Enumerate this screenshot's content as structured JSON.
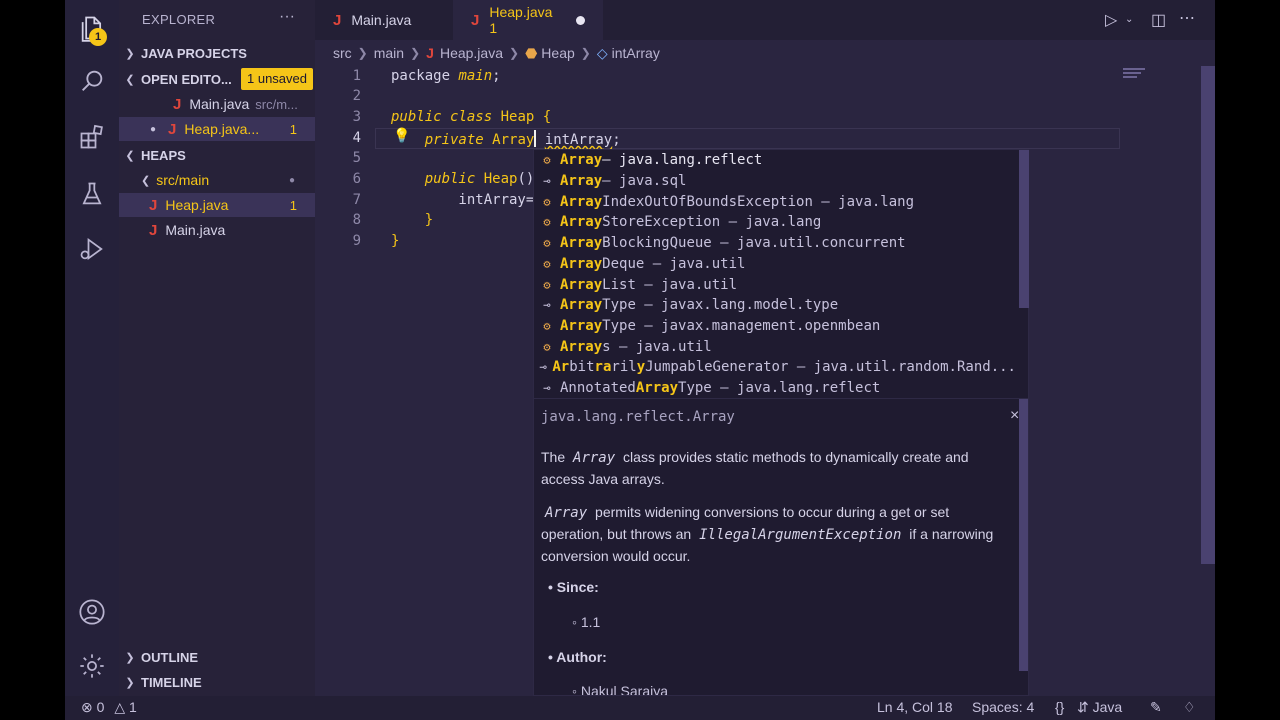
{
  "colors": {
    "accent": "#f5c518",
    "background": "#2a2540",
    "java_icon": "#e0463c"
  },
  "activity": {
    "explorer_badge": "1"
  },
  "sidebar": {
    "title": "EXPLORER",
    "more": "···",
    "java_projects": "JAVA PROJECTS",
    "open_editors": "OPEN EDITO...",
    "unsaved_pill": "1 unsaved",
    "open_files": [
      {
        "icon": "J",
        "name": "Main.java",
        "path": "src/m..."
      },
      {
        "icon": "J",
        "name": "Heap.java...",
        "count": "1"
      }
    ],
    "heaps": "HEAPS",
    "folder": "src/main",
    "tree_files": [
      {
        "icon": "J",
        "name": "Heap.java",
        "count": "1"
      },
      {
        "icon": "J",
        "name": "Main.java"
      }
    ],
    "outline": "OUTLINE",
    "timeline": "TIMELINE"
  },
  "tabs": [
    {
      "icon": "J",
      "label": "Main.java"
    },
    {
      "icon": "J",
      "label": "Heap.java 1"
    }
  ],
  "breadcrumbs": [
    "src",
    "main",
    "Heap.java",
    "Heap",
    "intArray"
  ],
  "editor": {
    "line_numbers": [
      "1",
      "2",
      "3",
      "4",
      "5",
      "6",
      "7",
      "8",
      "9"
    ],
    "lines": {
      "l1a": "package ",
      "l1b": "main",
      "l1c": ";",
      "l3a": "public",
      "l3b": " ",
      "l3c": "class",
      "l3d": " ",
      "l3e": "Heap",
      "l3f": " {",
      "l4a": "    ",
      "l4b": "private",
      "l4c": " ",
      "l4d": "Array",
      "l4e": " ",
      "l4f": "intArray",
      "l4g": ";",
      "l6a": "    ",
      "l6b": "public",
      "l6c": " ",
      "l6d": "Heap",
      "l6e": "()",
      "l7a": "        intArray=",
      "l8a": "    }",
      "l9a": "}"
    }
  },
  "suggestions": [
    {
      "icon": "class",
      "match": "Array",
      "rest": " – java.lang.reflect"
    },
    {
      "icon": "interface",
      "match": "Array",
      "rest": " – java.sql"
    },
    {
      "icon": "class",
      "match": "Array",
      "rest": "IndexOutOfBoundsException – java.lang"
    },
    {
      "icon": "class",
      "match": "Array",
      "rest": "StoreException – java.lang"
    },
    {
      "icon": "class",
      "match": "Array",
      "rest": "BlockingQueue – java.util.concurrent"
    },
    {
      "icon": "class",
      "match": "Array",
      "rest": "Deque – java.util"
    },
    {
      "icon": "class",
      "match": "Array",
      "rest": "List – java.util"
    },
    {
      "icon": "interface",
      "match": "Array",
      "rest": "Type – javax.lang.model.type"
    },
    {
      "icon": "class",
      "match": "Array",
      "rest": "Type – javax.management.openmbean"
    },
    {
      "icon": "class",
      "match": "Array",
      "rest": "s – java.util"
    },
    {
      "icon": "interface",
      "prefix": "",
      "rich": [
        [
          "Ar",
          true
        ],
        [
          "bit",
          false
        ],
        [
          "ra",
          true
        ],
        [
          "ril",
          false
        ],
        [
          "y",
          true
        ],
        [
          "JumpableGenerator – java.util.random.Rand...",
          false
        ]
      ]
    },
    {
      "icon": "interface",
      "pre": "Annotated",
      "match": "Array",
      "rest": "Type – java.lang.reflect"
    }
  ],
  "details": {
    "signature": "java.lang.reflect.Array",
    "close": "×",
    "p1a": "The ",
    "p1code": "Array",
    "p1b": " class provides static methods to dynamically create and access Java arrays.",
    "p2code": "Array",
    "p2a": " permits widening conversions to occur during a get or set operation, but throws an ",
    "p2code2": "IllegalArgumentException",
    "p2b": " if a narrowing conversion would occur.",
    "since_label": "Since:",
    "since_value": "1.1",
    "author_label": "Author:",
    "author_value": "Nakul Saraiya"
  },
  "status": {
    "errors": "0",
    "warnings": "1",
    "position": "Ln 4, Col 18",
    "spaces": "Spaces: 4",
    "braces": "{}",
    "language": "Java"
  }
}
